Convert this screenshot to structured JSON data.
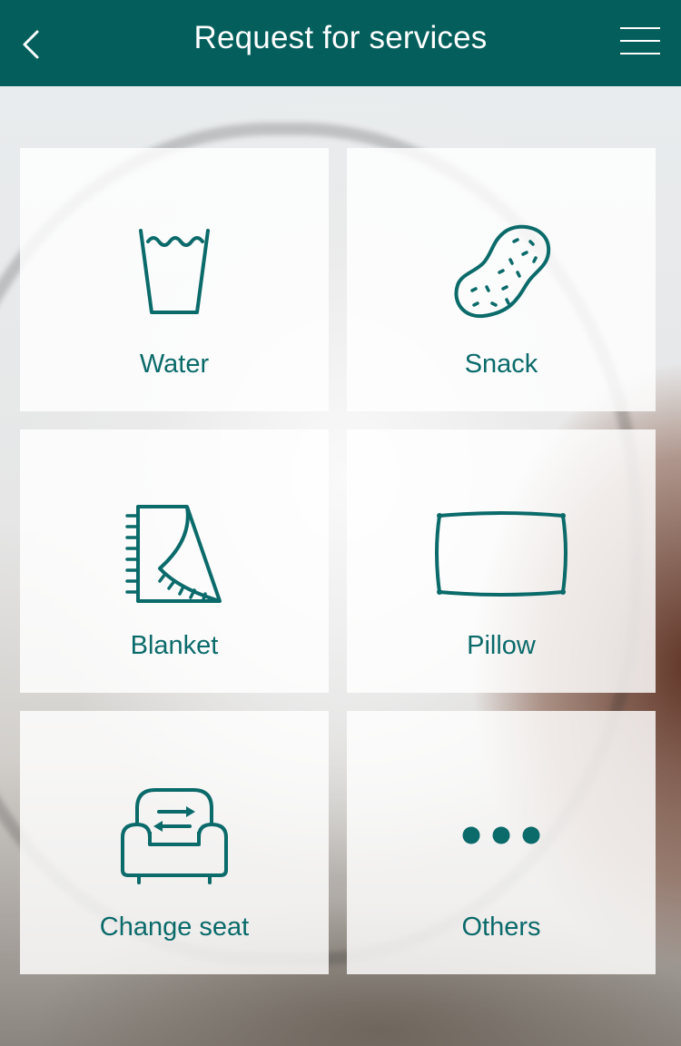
{
  "header": {
    "title": "Request for services",
    "back_icon": "chevron-left-icon",
    "menu_icon": "hamburger-menu-icon"
  },
  "colors": {
    "header_bg": "#045f5c",
    "accent": "#0b6a6a",
    "tile_bg": "rgba(255,255,255,0.82)"
  },
  "services": [
    {
      "label": "Water",
      "icon": "water-glass-icon"
    },
    {
      "label": "Snack",
      "icon": "peanut-icon"
    },
    {
      "label": "Blanket",
      "icon": "blanket-icon"
    },
    {
      "label": "Pillow",
      "icon": "pillow-icon"
    },
    {
      "label": "Change seat",
      "icon": "seat-swap-icon"
    },
    {
      "label": "Others",
      "icon": "more-dots-icon"
    }
  ]
}
